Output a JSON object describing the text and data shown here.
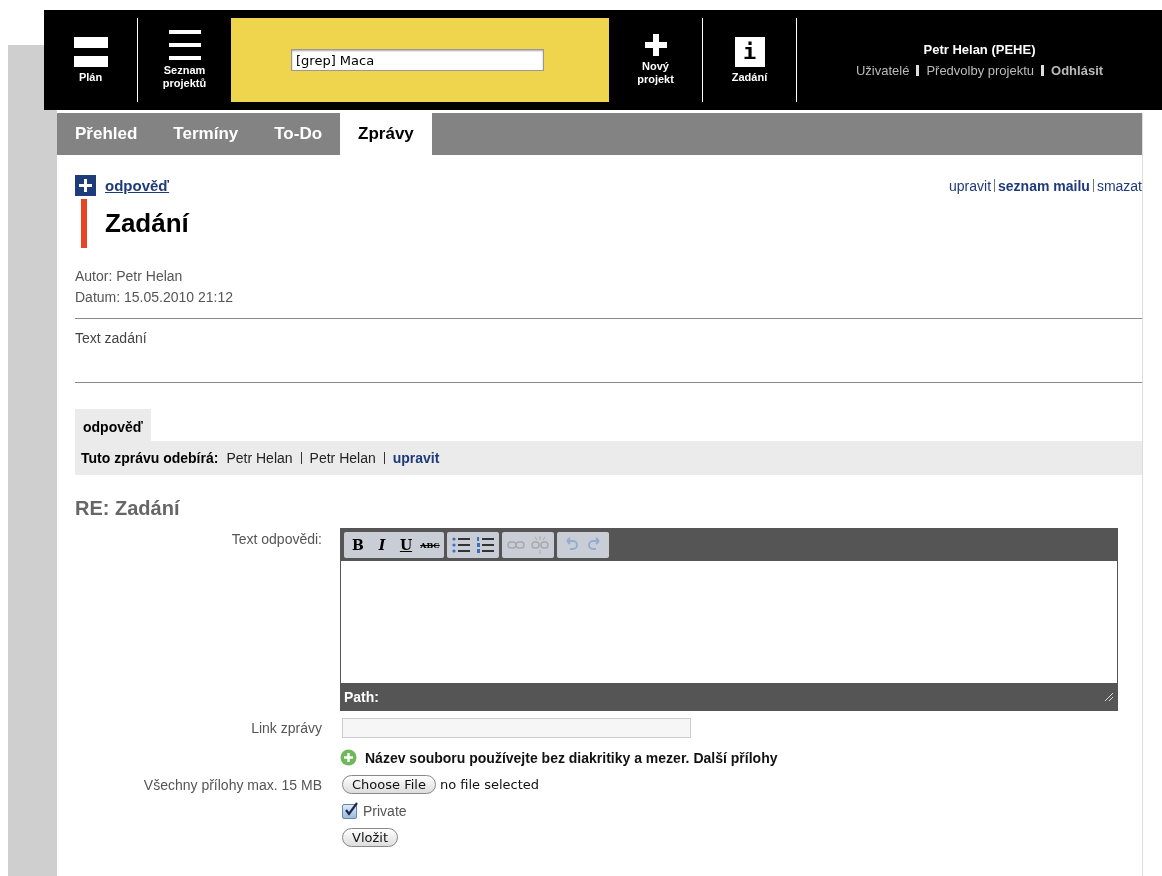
{
  "header": {
    "nav_left": [
      {
        "kind": "plan",
        "label": "Plán"
      },
      {
        "kind": "list",
        "label": "Seznam projektů"
      }
    ],
    "search": {
      "value": "[grep] Maca"
    },
    "nav_right": [
      {
        "kind": "plus",
        "label": "Nový projekt"
      },
      {
        "kind": "info",
        "label": "Zadání",
        "icon_text": "i"
      }
    ],
    "user": {
      "name": "Petr Helan (PEHE)",
      "links": [
        {
          "label": "Uživatelé",
          "bold": false
        },
        {
          "label": "Předvolby projektu",
          "bold": false
        },
        {
          "label": "Odhlásit",
          "bold": true
        }
      ]
    }
  },
  "tabs": [
    {
      "label": "Přehled",
      "selected": false
    },
    {
      "label": "Termíny",
      "selected": false
    },
    {
      "label": "To-Do",
      "selected": false
    },
    {
      "label": "Zprávy",
      "selected": true
    }
  ],
  "message": {
    "reply_link": "odpověď",
    "actions": [
      {
        "label": "upravit",
        "bold": false
      },
      {
        "label": "seznam mailu",
        "bold": true
      },
      {
        "label": "smazat",
        "bold": false
      }
    ],
    "title": "Zadání",
    "author": "Autor: Petr Helan",
    "date": "Datum: 15.05.2010 21:12",
    "body": "Text zadání"
  },
  "reply_box": {
    "tab_label": "odpověď",
    "subscribers_label": "Tuto zprávu odebírá:",
    "subscribers": [
      "Petr Helan",
      "Petr Helan"
    ],
    "edit_link": "upravit"
  },
  "form": {
    "title": "RE: Zadání",
    "editor_label": "Text odpovědi:",
    "toolbar": [
      [
        {
          "kind": "bold",
          "label": "B",
          "disabled": false
        },
        {
          "kind": "italic",
          "label": "I",
          "disabled": false
        },
        {
          "kind": "underline",
          "label": "U",
          "disabled": false
        },
        {
          "kind": "strike",
          "label": "ABC",
          "disabled": false
        }
      ],
      [
        {
          "kind": "bullets",
          "disabled": false
        },
        {
          "kind": "numbers",
          "disabled": false
        }
      ],
      [
        {
          "kind": "link",
          "disabled": true
        },
        {
          "kind": "unlink",
          "disabled": true
        }
      ],
      [
        {
          "kind": "undo",
          "disabled": true
        },
        {
          "kind": "redo",
          "disabled": true
        }
      ]
    ],
    "path_label": "Path:",
    "link_label": "Link zprávy",
    "note": "Název souboru používejte bez diakritiky a mezer.",
    "more_link": "Další přílohy",
    "attachments_label": "Všechny přílohy max. 15 MB",
    "choose_button": "Choose File",
    "file_status": "no file selected",
    "private": {
      "label": "Private",
      "checked": true
    },
    "submit": "Vložit"
  }
}
